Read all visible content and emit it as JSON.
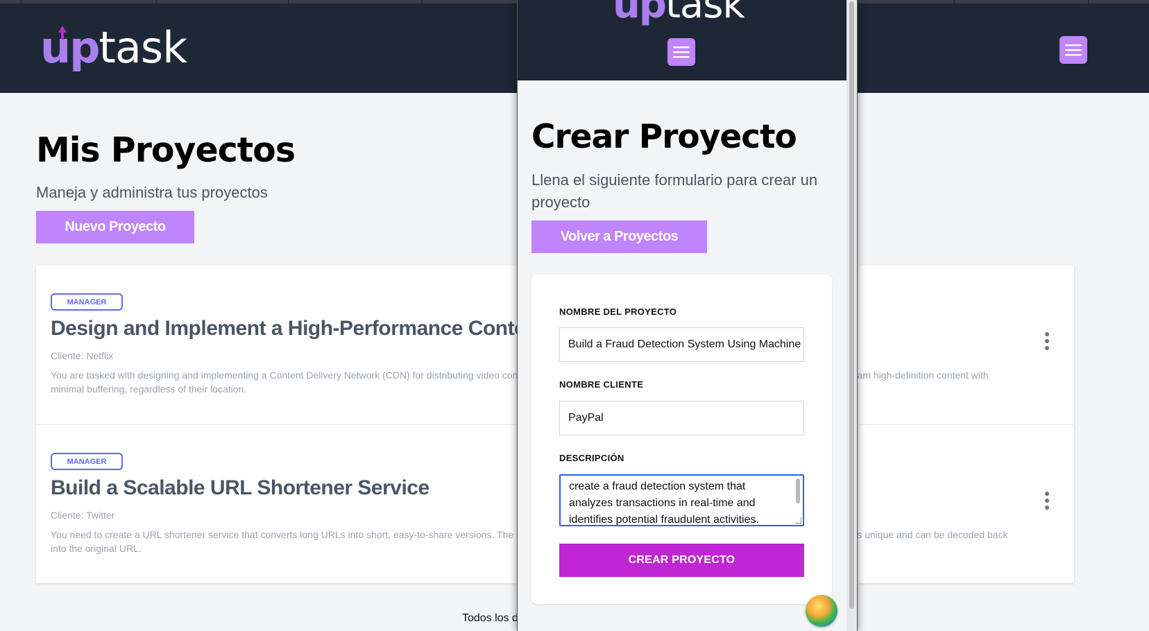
{
  "brand": {
    "logo_up": "up",
    "logo_task": "task"
  },
  "projects_page": {
    "title": "Mis Proyectos",
    "subtitle": "Maneja y administra tus proyectos",
    "new_button": "Nuevo Proyecto",
    "projects": [
      {
        "badge": "MANAGER",
        "title": "Design and Implement a High-Performance Content Delivery Network (CDN)",
        "client": "Cliente: Netflix",
        "description": "You are tasked with designing and implementing a Content Delivery Network (CDN) for distributing video content to users around the world. The CDN should enable users worldwide to stream high-definition content with minimal buffering, regardless of their location."
      },
      {
        "badge": "MANAGER",
        "title": "Build a Scalable URL Shortener Service",
        "client": "Cliente: Twitter",
        "description": "You need to create a URL shortener service that converts long URLs into short, easy-to-share versions. The service must handle millions of requests and must ensure that each short URL is unique and can be decoded back into the original URL."
      }
    ],
    "footer_text": "Todos los d"
  },
  "create_page": {
    "title": "Crear Proyecto",
    "subtitle": "Llena el siguiente formulario para crear un proyecto",
    "back_button": "Volver a Proyectos",
    "form": {
      "name_label": "NOMBRE DEL PROYECTO",
      "name_value": "Build a Fraud Detection System Using Machine Learning",
      "client_label": "NOMBRE CLIENTE",
      "client_value": "PayPal",
      "description_label": "DESCRIPCIÓN",
      "description_value": "create a fraud detection system that analyzes transactions in real-time and identifies potential fraudulent activities.",
      "submit_label": "CREAR PROYECTO"
    }
  },
  "colors": {
    "header_bg": "#1e2736",
    "accent_purple": "#c084fc",
    "submit_magenta": "#c026d3",
    "badge_indigo": "#6366f1"
  }
}
